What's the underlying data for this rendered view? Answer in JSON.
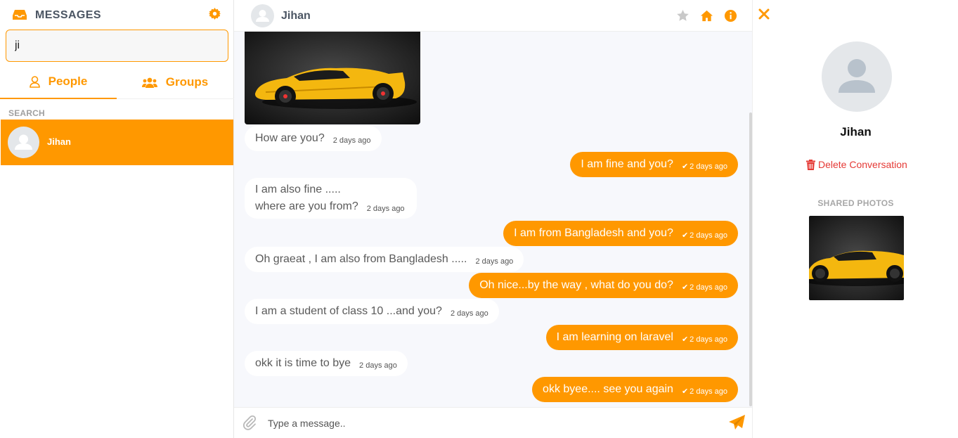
{
  "sidebar": {
    "title": "MESSAGES",
    "search": {
      "value": "ji",
      "placeholder": ""
    },
    "tabs": [
      {
        "label": "People"
      },
      {
        "label": "Groups"
      }
    ],
    "section_label": "SEARCH",
    "contacts": [
      {
        "name": "Jihan"
      }
    ]
  },
  "chat": {
    "header_name": "Jihan",
    "messages": [
      {
        "dir": "in",
        "text": "How are you?",
        "time": "2 days ago"
      },
      {
        "dir": "out",
        "text": "I am fine and you?",
        "time": "2 days ago"
      },
      {
        "dir": "in",
        "text": "I am also fine .....",
        "text2": "where are you from?",
        "time": "2 days ago"
      },
      {
        "dir": "out",
        "text": "I am from Bangladesh and you?",
        "time": "2 days ago"
      },
      {
        "dir": "in",
        "text": "Oh graeat , I am also from Bangladesh .....",
        "time": "2 days ago"
      },
      {
        "dir": "out",
        "text": "Oh nice...by the way , what do you do?",
        "time": "2 days ago"
      },
      {
        "dir": "in",
        "text": "I am a student of class 10 ...and you?",
        "time": "2 days ago"
      },
      {
        "dir": "out",
        "text": "I am learning on laravel",
        "time": "2 days ago"
      },
      {
        "dir": "in",
        "text": "okk it is time to bye",
        "time": "2 days ago"
      },
      {
        "dir": "out",
        "text": "okk byee.... see you again",
        "time": "2 days ago"
      }
    ],
    "composer": {
      "placeholder": "Type a message.."
    }
  },
  "info": {
    "name": "Jihan",
    "delete_label": "Delete Conversation",
    "shared_label": "SHARED PHOTOS"
  },
  "colors": {
    "accent": "#ff9800",
    "danger": "#e53935"
  }
}
